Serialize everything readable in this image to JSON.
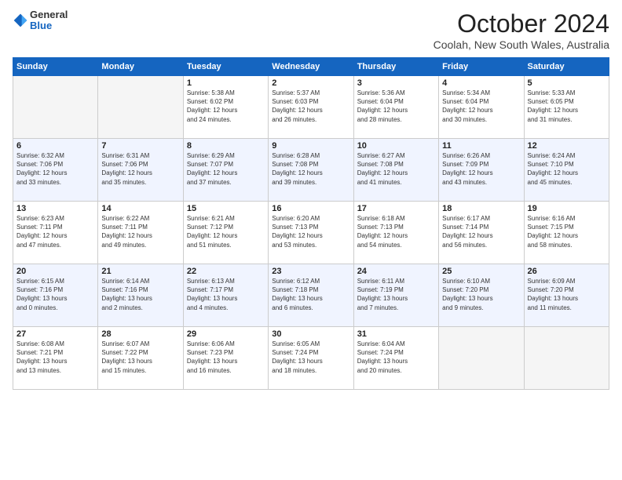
{
  "logo": {
    "general": "General",
    "blue": "Blue"
  },
  "title": "October 2024",
  "location": "Coolah, New South Wales, Australia",
  "days_of_week": [
    "Sunday",
    "Monday",
    "Tuesday",
    "Wednesday",
    "Thursday",
    "Friday",
    "Saturday"
  ],
  "weeks": [
    [
      {
        "day": "",
        "info": ""
      },
      {
        "day": "",
        "info": ""
      },
      {
        "day": "1",
        "info": "Sunrise: 5:38 AM\nSunset: 6:02 PM\nDaylight: 12 hours\nand 24 minutes."
      },
      {
        "day": "2",
        "info": "Sunrise: 5:37 AM\nSunset: 6:03 PM\nDaylight: 12 hours\nand 26 minutes."
      },
      {
        "day": "3",
        "info": "Sunrise: 5:36 AM\nSunset: 6:04 PM\nDaylight: 12 hours\nand 28 minutes."
      },
      {
        "day": "4",
        "info": "Sunrise: 5:34 AM\nSunset: 6:04 PM\nDaylight: 12 hours\nand 30 minutes."
      },
      {
        "day": "5",
        "info": "Sunrise: 5:33 AM\nSunset: 6:05 PM\nDaylight: 12 hours\nand 31 minutes."
      }
    ],
    [
      {
        "day": "6",
        "info": "Sunrise: 6:32 AM\nSunset: 7:06 PM\nDaylight: 12 hours\nand 33 minutes."
      },
      {
        "day": "7",
        "info": "Sunrise: 6:31 AM\nSunset: 7:06 PM\nDaylight: 12 hours\nand 35 minutes."
      },
      {
        "day": "8",
        "info": "Sunrise: 6:29 AM\nSunset: 7:07 PM\nDaylight: 12 hours\nand 37 minutes."
      },
      {
        "day": "9",
        "info": "Sunrise: 6:28 AM\nSunset: 7:08 PM\nDaylight: 12 hours\nand 39 minutes."
      },
      {
        "day": "10",
        "info": "Sunrise: 6:27 AM\nSunset: 7:08 PM\nDaylight: 12 hours\nand 41 minutes."
      },
      {
        "day": "11",
        "info": "Sunrise: 6:26 AM\nSunset: 7:09 PM\nDaylight: 12 hours\nand 43 minutes."
      },
      {
        "day": "12",
        "info": "Sunrise: 6:24 AM\nSunset: 7:10 PM\nDaylight: 12 hours\nand 45 minutes."
      }
    ],
    [
      {
        "day": "13",
        "info": "Sunrise: 6:23 AM\nSunset: 7:11 PM\nDaylight: 12 hours\nand 47 minutes."
      },
      {
        "day": "14",
        "info": "Sunrise: 6:22 AM\nSunset: 7:11 PM\nDaylight: 12 hours\nand 49 minutes."
      },
      {
        "day": "15",
        "info": "Sunrise: 6:21 AM\nSunset: 7:12 PM\nDaylight: 12 hours\nand 51 minutes."
      },
      {
        "day": "16",
        "info": "Sunrise: 6:20 AM\nSunset: 7:13 PM\nDaylight: 12 hours\nand 53 minutes."
      },
      {
        "day": "17",
        "info": "Sunrise: 6:18 AM\nSunset: 7:13 PM\nDaylight: 12 hours\nand 54 minutes."
      },
      {
        "day": "18",
        "info": "Sunrise: 6:17 AM\nSunset: 7:14 PM\nDaylight: 12 hours\nand 56 minutes."
      },
      {
        "day": "19",
        "info": "Sunrise: 6:16 AM\nSunset: 7:15 PM\nDaylight: 12 hours\nand 58 minutes."
      }
    ],
    [
      {
        "day": "20",
        "info": "Sunrise: 6:15 AM\nSunset: 7:16 PM\nDaylight: 13 hours\nand 0 minutes."
      },
      {
        "day": "21",
        "info": "Sunrise: 6:14 AM\nSunset: 7:16 PM\nDaylight: 13 hours\nand 2 minutes."
      },
      {
        "day": "22",
        "info": "Sunrise: 6:13 AM\nSunset: 7:17 PM\nDaylight: 13 hours\nand 4 minutes."
      },
      {
        "day": "23",
        "info": "Sunrise: 6:12 AM\nSunset: 7:18 PM\nDaylight: 13 hours\nand 6 minutes."
      },
      {
        "day": "24",
        "info": "Sunrise: 6:11 AM\nSunset: 7:19 PM\nDaylight: 13 hours\nand 7 minutes."
      },
      {
        "day": "25",
        "info": "Sunrise: 6:10 AM\nSunset: 7:20 PM\nDaylight: 13 hours\nand 9 minutes."
      },
      {
        "day": "26",
        "info": "Sunrise: 6:09 AM\nSunset: 7:20 PM\nDaylight: 13 hours\nand 11 minutes."
      }
    ],
    [
      {
        "day": "27",
        "info": "Sunrise: 6:08 AM\nSunset: 7:21 PM\nDaylight: 13 hours\nand 13 minutes."
      },
      {
        "day": "28",
        "info": "Sunrise: 6:07 AM\nSunset: 7:22 PM\nDaylight: 13 hours\nand 15 minutes."
      },
      {
        "day": "29",
        "info": "Sunrise: 6:06 AM\nSunset: 7:23 PM\nDaylight: 13 hours\nand 16 minutes."
      },
      {
        "day": "30",
        "info": "Sunrise: 6:05 AM\nSunset: 7:24 PM\nDaylight: 13 hours\nand 18 minutes."
      },
      {
        "day": "31",
        "info": "Sunrise: 6:04 AM\nSunset: 7:24 PM\nDaylight: 13 hours\nand 20 minutes."
      },
      {
        "day": "",
        "info": ""
      },
      {
        "day": "",
        "info": ""
      }
    ]
  ]
}
